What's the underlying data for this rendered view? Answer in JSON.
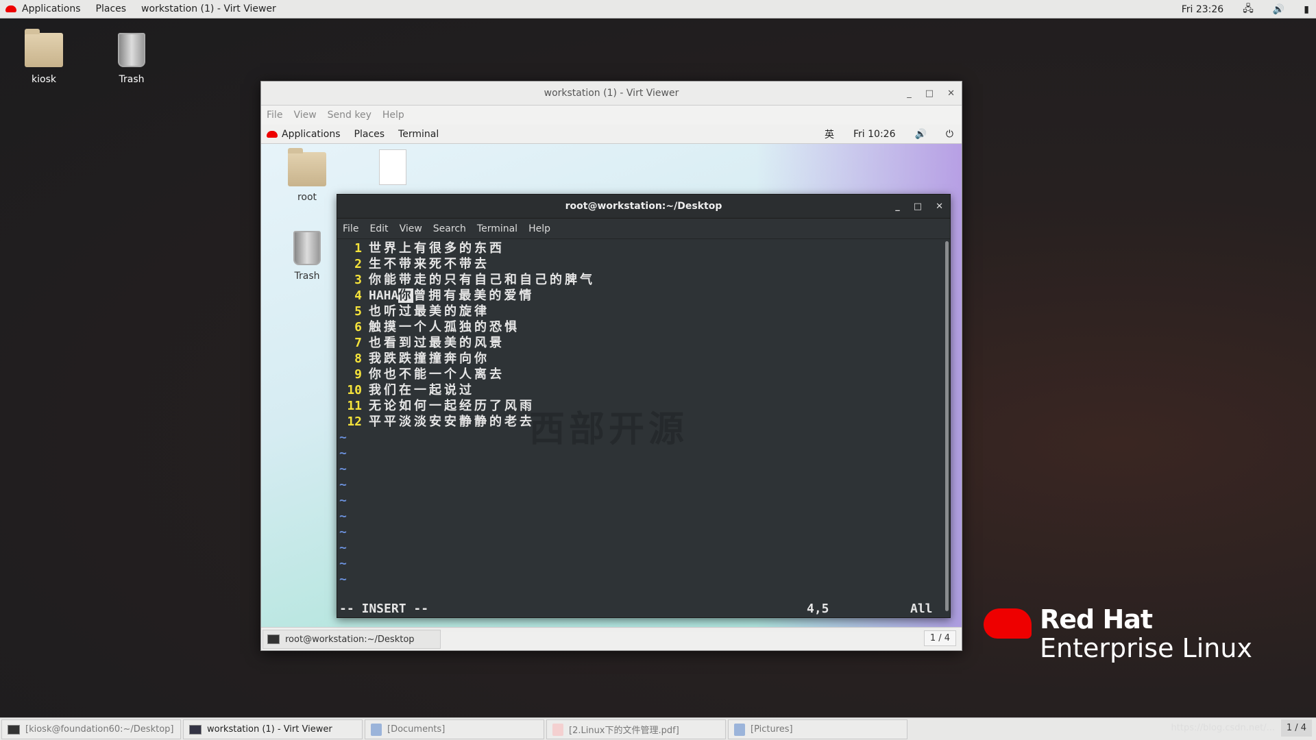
{
  "topbar": {
    "applications": "Applications",
    "places": "Places",
    "window": "workstation (1) - Virt Viewer",
    "clock": "Fri 23:26"
  },
  "desktop": {
    "icons": [
      {
        "label": "kiosk"
      },
      {
        "label": "Trash"
      }
    ]
  },
  "virt_viewer": {
    "title": "workstation (1) - Virt Viewer",
    "menu": [
      "File",
      "View",
      "Send key",
      "Help"
    ],
    "guest": {
      "topbar": {
        "applications": "Applications",
        "places": "Places",
        "terminal": "Terminal",
        "input_method": "英",
        "clock": "Fri 10:26"
      },
      "icons": [
        {
          "label": "root"
        },
        {
          "label": "Trash"
        }
      ],
      "watermark": "西部开源",
      "terminal": {
        "title": "root@workstation:~/Desktop",
        "menu": [
          "File",
          "Edit",
          "View",
          "Search",
          "Terminal",
          "Help"
        ],
        "lines": [
          {
            "n": "1",
            "text": "世界上有很多的东西"
          },
          {
            "n": "2",
            "text": "生不带来死不带去"
          },
          {
            "n": "3",
            "text": "你能带走的只有自己和自己的脾气"
          },
          {
            "n": "4",
            "pre": "HAHA",
            "cursor": "你",
            "text": "曾拥有最美的爱情"
          },
          {
            "n": "5",
            "text": "也听过最美的旋律"
          },
          {
            "n": "6",
            "text": "触摸一个人孤独的恐惧"
          },
          {
            "n": "7",
            "text": "也看到过最美的风景"
          },
          {
            "n": "8",
            "text": "我跌跌撞撞奔向你"
          },
          {
            "n": "9",
            "text": "你也不能一个人离去"
          },
          {
            "n": "10",
            "text": "我们在一起说过"
          },
          {
            "n": "11",
            "text": "无论如何一起经历了风雨"
          },
          {
            "n": "12",
            "text": "平平淡淡安安静静的老去"
          }
        ],
        "tilde": "~",
        "mode": "-- INSERT --",
        "position": "4,5",
        "scroll": "All"
      },
      "taskbar": {
        "item": "root@workstation:~/Desktop",
        "pager": "1 / 4"
      }
    }
  },
  "brand": {
    "line1": "Red Hat",
    "line2": "Enterprise Linux",
    "color": "#ee0000"
  },
  "taskbar": {
    "items": [
      "[kiosk@foundation60:~/Desktop]",
      "workstation (1) - Virt Viewer",
      "[Documents]",
      "[2.Linux下的文件管理.pdf]",
      "[Pictures]"
    ],
    "watermark": "https://blog.csdn.net/...",
    "pager": "1 / 4"
  }
}
